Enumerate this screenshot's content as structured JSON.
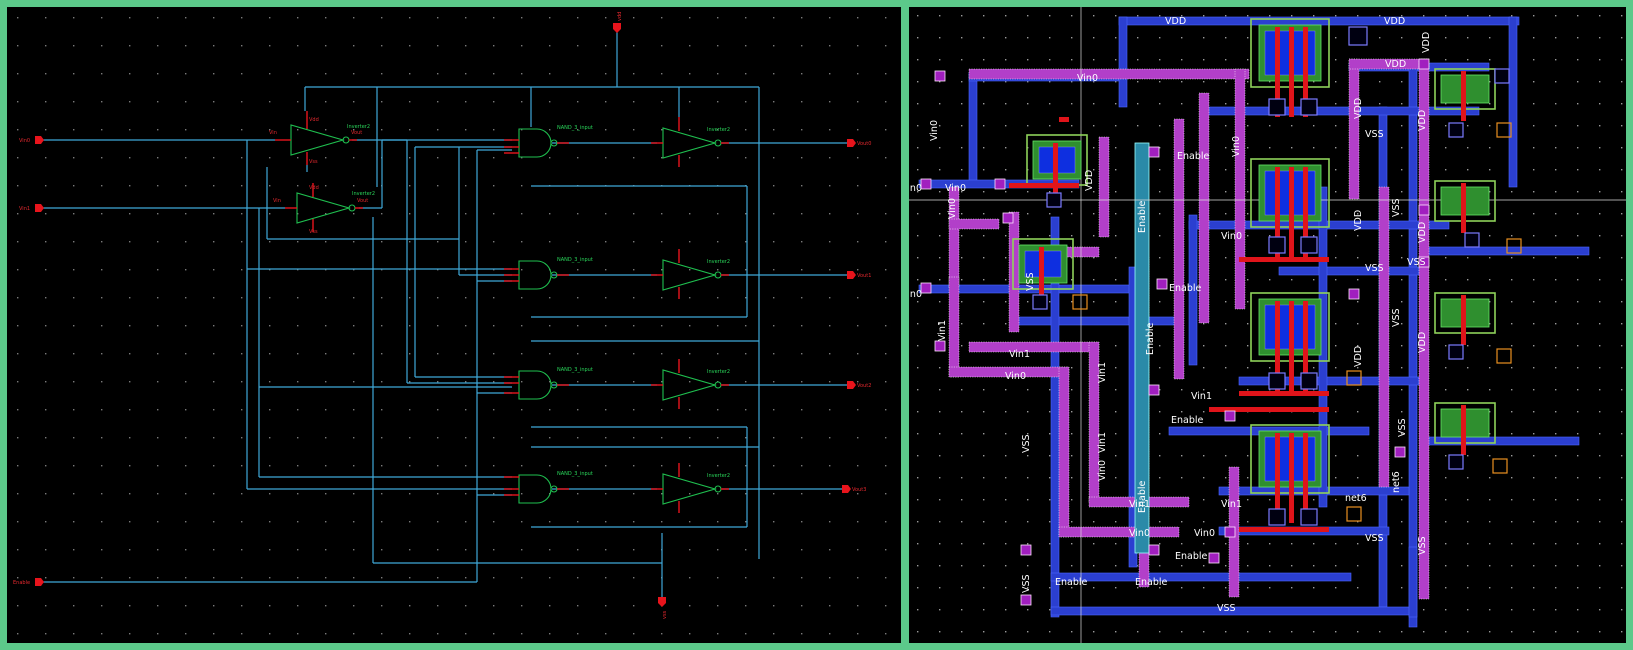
{
  "schematic": {
    "input_pins": [
      "Vin0",
      "Vin1",
      "Enable"
    ],
    "output_pins": [
      "Vout0",
      "Vout1",
      "Vout2",
      "Vout3"
    ],
    "supply_pins": {
      "top": "vdd",
      "bottom": "vss"
    },
    "inverter_labels": [
      "Inverter2",
      "Inverter2"
    ],
    "nand_label": "NAND_3_input",
    "nand_pins": [
      "in1",
      "in2",
      "in3",
      "out"
    ],
    "inverter_pins": [
      "Vin",
      "Vout",
      "Vdd",
      "Vss"
    ],
    "output_inverter_label": "Inverter2"
  },
  "layout": {
    "net_labels": {
      "vdd": "VDD",
      "vss": "VSS",
      "vin0": "Vin0",
      "vin1": "Vin1",
      "enable": "Enable",
      "net6": "net6"
    }
  },
  "colors": {
    "background": "#000000",
    "border": "#5cc98a",
    "wire": "#3fa8d8",
    "pin": "#e8141c",
    "symbol": "#1fbf4f",
    "metal1": "#2b3fd0",
    "metal2": "#b23fc9",
    "poly": "#e0141a"
  }
}
